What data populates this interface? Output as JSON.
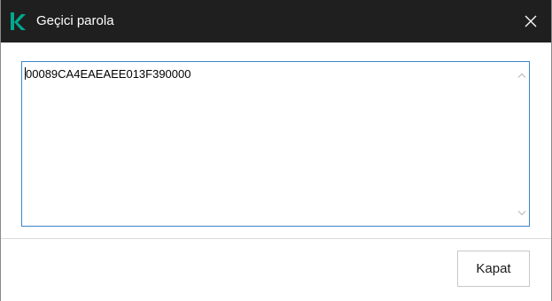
{
  "window": {
    "title": "Geçici parola",
    "accent_color": "#00a88e",
    "titlebar_color": "#1f1f1f"
  },
  "content": {
    "password_value": "00089CA4EAEAEE013F390000"
  },
  "footer": {
    "close_label": "Kapat"
  },
  "icons": {
    "app_logo": "kaspersky-k-logo",
    "close": "close-icon",
    "scroll_up": "chevron-up-icon",
    "scroll_down": "chevron-down-icon"
  }
}
